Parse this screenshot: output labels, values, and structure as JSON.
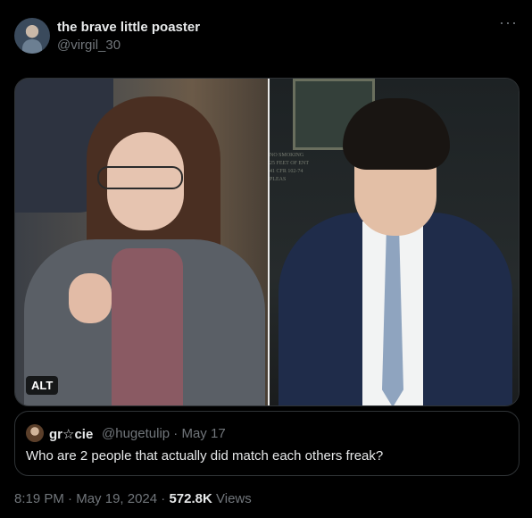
{
  "author": {
    "display_name": "the brave little poaster",
    "handle": "@virgil_30",
    "avatar_icon": "user-avatar"
  },
  "menu": {
    "more_label": "···"
  },
  "media": {
    "alt_badge": "ALT",
    "left_photo_sign_text": "NO SMOKING\n25 FEET OF ENT\n41 CFR 102-74",
    "right_photo_sign_text": "PLEAS"
  },
  "quoted_tweet": {
    "display_name": "gr☆cie",
    "handle": "@hugetulip",
    "date": "May 17",
    "text": "Who are 2 people that actually did match each others freak?"
  },
  "footer": {
    "time": "8:19 PM",
    "date": "May 19, 2024",
    "views_count": "572.8K",
    "views_label": "Views"
  }
}
